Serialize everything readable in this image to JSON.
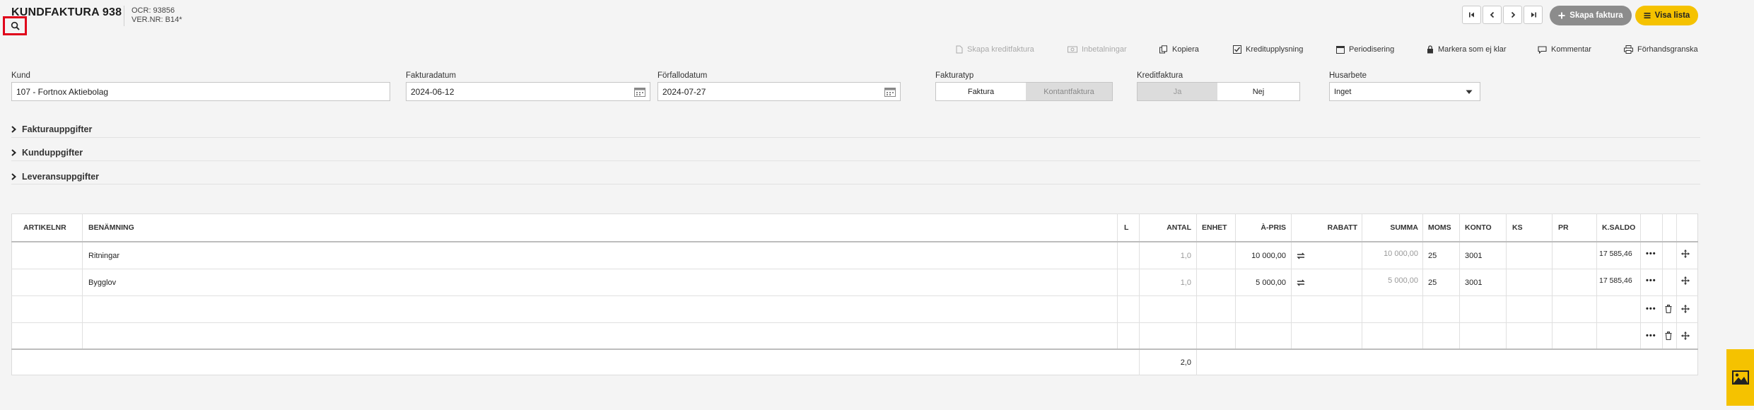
{
  "header": {
    "title": "KUNDFAKTURA 938",
    "ocr": "OCR: 93856",
    "vernr": "VER.NR: B14*",
    "create_invoice": "Skapa faktura",
    "show_list": "Visa lista"
  },
  "actions": {
    "create_credit": "Skapa kreditfaktura",
    "payments": "Inbetalningar",
    "copy": "Kopiera",
    "credit_info": "Kreditupplysning",
    "accrual": "Periodisering",
    "mark_unready": "Markera som ej klar",
    "comment": "Kommentar",
    "preview": "Förhandsgranska"
  },
  "form": {
    "customer_label": "Kund",
    "customer_value": "107 - Fortnox Aktiebolag",
    "invoice_date_label": "Fakturadatum",
    "invoice_date": "2024-06-12",
    "due_date_label": "Förfallodatum",
    "due_date": "2024-07-27",
    "invoice_type_label": "Fakturatyp",
    "type_invoice": "Faktura",
    "type_cash": "Kontantfaktura",
    "credit_label": "Kreditfaktura",
    "credit_yes": "Ja",
    "credit_no": "Nej",
    "house_work_label": "Husarbete",
    "house_work_value": "Inget"
  },
  "sections": {
    "invoice_details": "Fakturauppgifter",
    "customer_details": "Kunduppgifter",
    "delivery_details": "Leveransuppgifter"
  },
  "table": {
    "headers": {
      "artnr": "ARTIKELNR",
      "name": "BENÄMNING",
      "l": "L",
      "qty": "ANTAL",
      "unit": "ENHET",
      "price": "À-PRIS",
      "discount": "RABATT",
      "sum": "SUMMA",
      "vat": "MOMS",
      "account": "KONTO",
      "ks": "KS",
      "pr": "PR",
      "ksaldo": "K.SALDO"
    },
    "rows": [
      {
        "name": "Ritningar",
        "qty": "1,0",
        "price": "10 000,00",
        "sum": "10 000,00",
        "vat": "25",
        "account": "3001",
        "ksaldo": "17 585,46"
      },
      {
        "name": "Bygglov",
        "qty": "1,0",
        "price": "5 000,00",
        "sum": "5 000,00",
        "vat": "25",
        "account": "3001",
        "ksaldo": "17 585,46"
      }
    ],
    "total_qty": "2,0"
  }
}
